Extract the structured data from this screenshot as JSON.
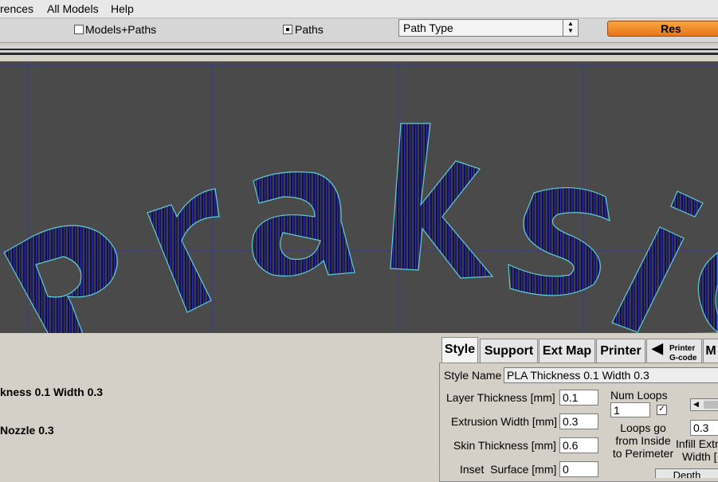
{
  "menu": {
    "items": [
      "rences",
      "All Models",
      "Help"
    ]
  },
  "toolbar": {
    "models_paths_label": "Models+Paths",
    "models_paths_checked": false,
    "paths_label": "Paths",
    "paths_selected": true,
    "path_type_value": "Path Type",
    "action_button_label": "Res"
  },
  "viewport": {
    "background": "#4a4a4a",
    "outline_color": "#5fd0d8",
    "infill_color": "#0a0a7a",
    "grid_color": "#3a3a9a",
    "text": "Praksis"
  },
  "info": {
    "line1": "kness 0.1 Width 0.3",
    "line2": "Nozzle 0.3"
  },
  "tabs": [
    {
      "label": "Style",
      "active": true
    },
    {
      "label": "Support",
      "active": false
    },
    {
      "label": "Ext Map",
      "active": false
    },
    {
      "label": "Printer",
      "active": false
    },
    {
      "label_line1": "Printer",
      "label_line2": "G-code",
      "active": false
    },
    {
      "label": "M",
      "active": false
    }
  ],
  "style": {
    "style_name_label": "Style Name",
    "style_name_value": "PLA Thickness 0.1 Width 0.3",
    "layer_thickness_label": "Layer Thickness [mm]",
    "layer_thickness_value": "0.1",
    "extrusion_width_label": "Extrusion Width [mm]",
    "extrusion_width_value": "0.3",
    "skin_thickness_label": "Skin Thickness [mm]",
    "skin_thickness_value": "0.6",
    "inset_surface_label": "Inset  Surface [mm]",
    "inset_surface_value": "0",
    "num_loops_label": "Num Loops",
    "num_loops_value": "1",
    "loops_checked": true,
    "loops_label_1": "Loops go",
    "loops_label_2": "from Inside",
    "loops_label_3": "to Perimeter",
    "infill_value": "0.3",
    "infill_label_1": "Infill Extr",
    "infill_label_2": "Width [",
    "depth_label": "Depth"
  }
}
